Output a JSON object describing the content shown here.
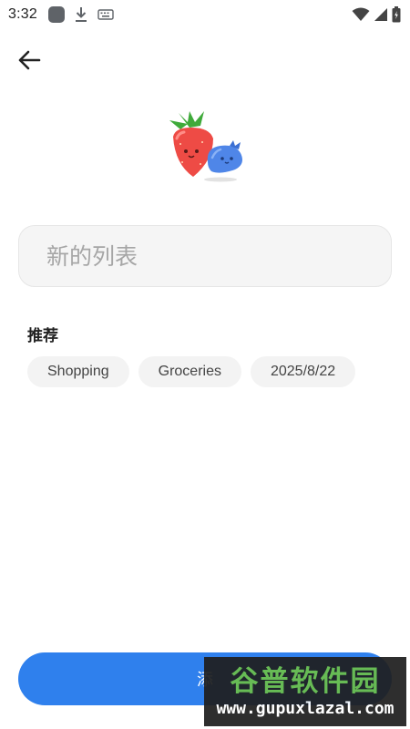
{
  "status_bar": {
    "time": "3:32",
    "left_icons": [
      "app-icon",
      "download-icon",
      "keyboard-icon"
    ],
    "right_icons": [
      "wifi-icon",
      "signal-icon",
      "battery-icon"
    ]
  },
  "header": {
    "back_icon": "arrow-left-icon"
  },
  "illustration": {
    "icon": "strawberry-blueberry-icon"
  },
  "list_name": {
    "placeholder": "新的列表",
    "value": ""
  },
  "suggestions": {
    "title": "推荐",
    "chips": [
      {
        "label": "Shopping"
      },
      {
        "label": "Groceries"
      },
      {
        "label": "2025/8/22"
      }
    ]
  },
  "add_button": {
    "label": "添"
  },
  "watermark": {
    "title": "谷普软件园",
    "url": "www.gupuxlazal.com"
  },
  "colors": {
    "accent": "#2f80ed",
    "field_bg": "#f5f5f5",
    "chip_bg": "#f3f3f3",
    "watermark_green": "#6cc04a"
  }
}
